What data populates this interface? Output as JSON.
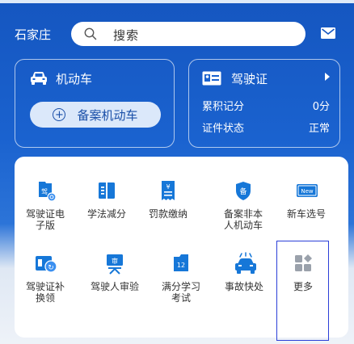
{
  "header": {
    "city": "石家庄",
    "search_placeholder": "搜索"
  },
  "vehicle_card": {
    "title": "机动车",
    "register_button": "备案机动车"
  },
  "license_card": {
    "title": "驾驶证",
    "points_label": "累积记分",
    "points_value": "0分",
    "status_label": "证件状态",
    "status_value": "正常"
  },
  "services": [
    {
      "label": "驾驶证电子版",
      "icon": "e-license-icon"
    },
    {
      "label": "学法减分",
      "icon": "book-icon"
    },
    {
      "label": "罚款缴纳",
      "icon": "fine-payment-icon"
    },
    {
      "label": "备案非本人机动车",
      "icon": "register-badge-icon"
    },
    {
      "label": "新车选号",
      "icon": "new-plate-icon"
    },
    {
      "label": "驾驶证补换领",
      "icon": "license-replace-icon"
    },
    {
      "label": "驾驶人审验",
      "icon": "driver-review-icon"
    },
    {
      "label": "满分学习考试",
      "icon": "full-score-exam-icon"
    },
    {
      "label": "事故快处",
      "icon": "accident-icon"
    },
    {
      "label": "更多",
      "icon": "more-grid-icon"
    }
  ],
  "service_icon_badges": {
    "e_license": "驾",
    "review": "审",
    "register": "备",
    "new_plate": "New",
    "exam": "12"
  },
  "colors": {
    "primary": "#1556c0",
    "icon_blue": "#1677d8",
    "more_gray": "#9aa1ab",
    "highlight": "#2b3fd8"
  }
}
